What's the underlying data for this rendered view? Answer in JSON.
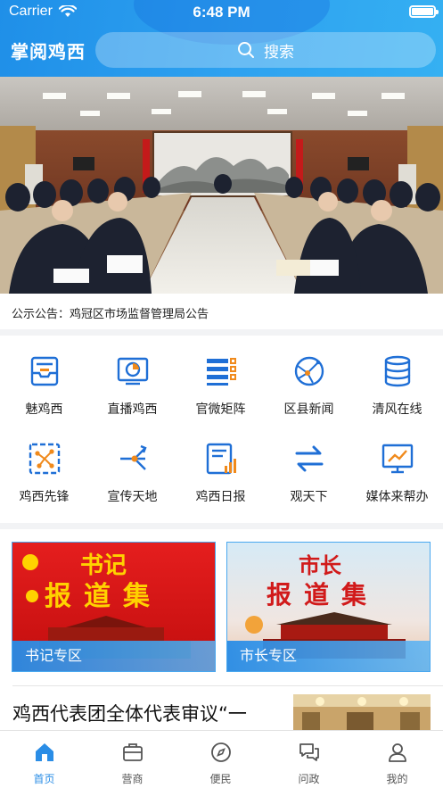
{
  "status_bar": {
    "carrier": "Carrier",
    "time": "6:48 PM"
  },
  "header": {
    "title": "掌阅鸡西",
    "search_placeholder": "搜索"
  },
  "notice": {
    "text": "公示公告：鸡冠区市场监督管理局公告"
  },
  "grid": [
    {
      "label": "魅鸡西",
      "icon": "inbox-tray-icon"
    },
    {
      "label": "直播鸡西",
      "icon": "live-chart-icon"
    },
    {
      "label": "官微矩阵",
      "icon": "matrix-list-icon"
    },
    {
      "label": "区县新闻",
      "icon": "globe-network-icon"
    },
    {
      "label": "清风在线",
      "icon": "database-icon"
    },
    {
      "label": "鸡西先锋",
      "icon": "network-node-icon"
    },
    {
      "label": "宣传天地",
      "icon": "share-broadcast-icon"
    },
    {
      "label": "鸡西日报",
      "icon": "newspaper-chart-icon"
    },
    {
      "label": "观天下",
      "icon": "exchange-arrows-icon"
    },
    {
      "label": "媒体来帮办",
      "icon": "trend-board-icon"
    }
  ],
  "columns": [
    {
      "label": "书记专区",
      "poster_line1": "书记",
      "poster_line2": "报道集"
    },
    {
      "label": "市长专区",
      "poster_line1": "市长",
      "poster_line2": "报道集"
    }
  ],
  "news": {
    "title": "鸡西代表团全体代表审议“一"
  },
  "tabs": [
    {
      "label": "首页",
      "icon": "home-icon",
      "active": true
    },
    {
      "label": "营商",
      "icon": "briefcase-icon",
      "active": false
    },
    {
      "label": "便民",
      "icon": "compass-icon",
      "active": false
    },
    {
      "label": "问政",
      "icon": "chat-bubbles-icon",
      "active": false
    },
    {
      "label": "我的",
      "icon": "user-icon",
      "active": false
    }
  ],
  "colors": {
    "primary": "#2a8de6",
    "header_start": "#1f8fe8",
    "header_end": "#35b0f2",
    "icon_blue": "#1f6fd6",
    "icon_orange": "#f08a1c"
  }
}
